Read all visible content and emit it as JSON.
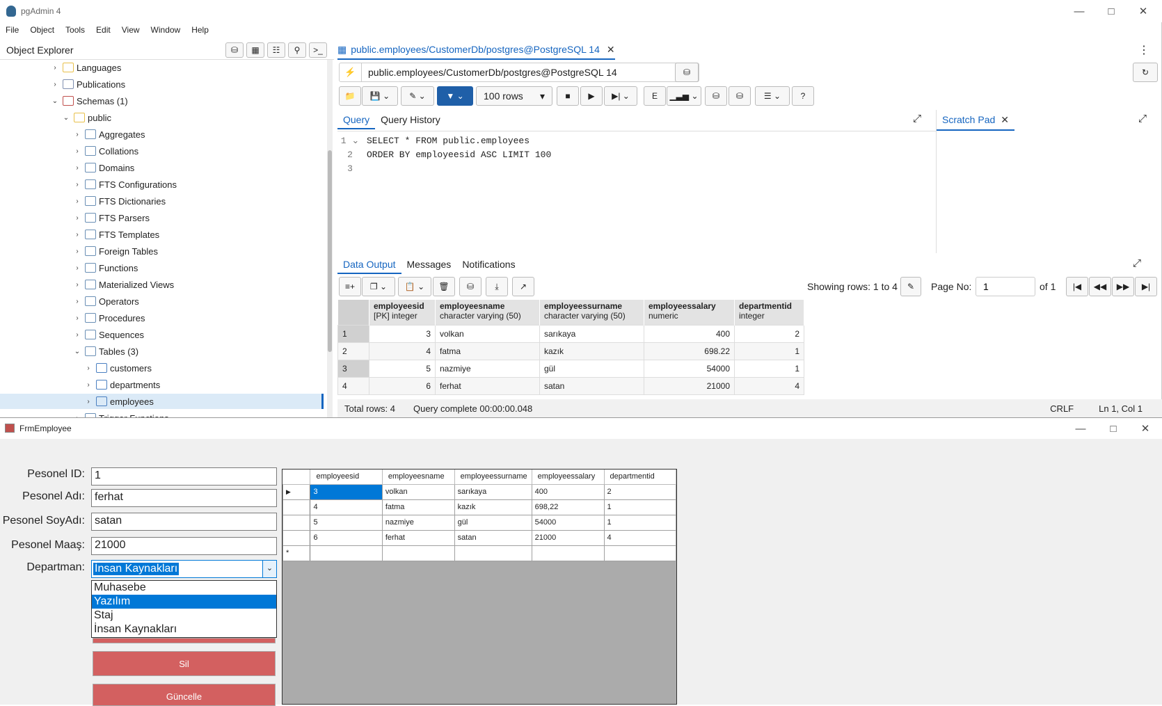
{
  "app": {
    "title": "pgAdmin 4",
    "menu": [
      "File",
      "Object",
      "Tools",
      "Edit",
      "View",
      "Window",
      "Help"
    ]
  },
  "object_explorer": {
    "title": "Object Explorer",
    "tree": [
      {
        "label": "Languages",
        "level": 0,
        "state": "collapsed",
        "icon": "language-icon"
      },
      {
        "label": "Publications",
        "level": 0,
        "state": "collapsed",
        "icon": "publication-icon"
      },
      {
        "label": "Schemas (1)",
        "level": 0,
        "state": "expanded",
        "icon": "schema-icon"
      },
      {
        "label": "public",
        "level": 1,
        "state": "expanded",
        "icon": "schema-public-icon"
      },
      {
        "label": "Aggregates",
        "level": 2,
        "state": "collapsed",
        "icon": "aggregate-icon"
      },
      {
        "label": "Collations",
        "level": 2,
        "state": "collapsed",
        "icon": "collation-icon"
      },
      {
        "label": "Domains",
        "level": 2,
        "state": "collapsed",
        "icon": "domain-icon"
      },
      {
        "label": "FTS Configurations",
        "level": 2,
        "state": "collapsed",
        "icon": "fts-config-icon"
      },
      {
        "label": "FTS Dictionaries",
        "level": 2,
        "state": "collapsed",
        "icon": "fts-dictionary-icon"
      },
      {
        "label": "FTS Parsers",
        "level": 2,
        "state": "collapsed",
        "icon": "fts-parser-icon"
      },
      {
        "label": "FTS Templates",
        "level": 2,
        "state": "collapsed",
        "icon": "fts-template-icon"
      },
      {
        "label": "Foreign Tables",
        "level": 2,
        "state": "collapsed",
        "icon": "foreign-table-icon"
      },
      {
        "label": "Functions",
        "level": 2,
        "state": "collapsed",
        "icon": "function-icon"
      },
      {
        "label": "Materialized Views",
        "level": 2,
        "state": "collapsed",
        "icon": "matview-icon"
      },
      {
        "label": "Operators",
        "level": 2,
        "state": "collapsed",
        "icon": "operator-icon"
      },
      {
        "label": "Procedures",
        "level": 2,
        "state": "collapsed",
        "icon": "procedure-icon"
      },
      {
        "label": "Sequences",
        "level": 2,
        "state": "collapsed",
        "icon": "sequence-icon"
      },
      {
        "label": "Tables (3)",
        "level": 2,
        "state": "expanded",
        "icon": "tables-icon"
      },
      {
        "label": "customers",
        "level": 3,
        "state": "collapsed",
        "icon": "table-icon"
      },
      {
        "label": "departments",
        "level": 3,
        "state": "collapsed",
        "icon": "table-icon"
      },
      {
        "label": "employees",
        "level": 3,
        "state": "collapsed",
        "icon": "table-icon",
        "selected": true
      },
      {
        "label": "Trigger Functions",
        "level": 2,
        "state": "collapsed",
        "icon": "trigger-function-icon"
      }
    ]
  },
  "query_tool": {
    "tab_label": "public.employees/CustomerDb/postgres@PostgreSQL 14",
    "connection": "public.employees/CustomerDb/postgres@PostgreSQL 14",
    "rows_limit": "100 rows",
    "editor_tabs": [
      "Query",
      "Query History"
    ],
    "scratch_pad": "Scratch Pad",
    "code_lines": [
      "SELECT * FROM public.employees",
      "ORDER BY employeesid ASC LIMIT 100",
      ""
    ],
    "output_tabs": [
      "Data Output",
      "Messages",
      "Notifications"
    ],
    "showing_rows": "Showing rows: 1 to 4",
    "page_no_label": "Page No:",
    "page_no": "1",
    "page_of": "of 1",
    "columns": [
      {
        "name": "employeesid",
        "type": "[PK] integer"
      },
      {
        "name": "employeesname",
        "type": "character varying (50)"
      },
      {
        "name": "employeessurname",
        "type": "character varying (50)"
      },
      {
        "name": "employeessalary",
        "type": "numeric"
      },
      {
        "name": "departmentid",
        "type": "integer"
      }
    ],
    "rows": [
      [
        "1",
        "3",
        "volkan",
        "sarıkaya",
        "400",
        "2"
      ],
      [
        "2",
        "4",
        "fatma",
        "kazık",
        "698.22",
        "1"
      ],
      [
        "3",
        "5",
        "nazmiye",
        "gül",
        "54000",
        "1"
      ],
      [
        "4",
        "6",
        "ferhat",
        "satan",
        "21000",
        "4"
      ]
    ],
    "status": {
      "total": "Total rows: 4",
      "query": "Query complete 00:00:00.048",
      "eol": "CRLF",
      "pos": "Ln 1, Col 1"
    }
  },
  "form": {
    "title": "FrmEmployee",
    "labels": {
      "id": "Pesonel ID:",
      "name": "Pesonel Adı:",
      "surname": "Pesonel SoyAdı:",
      "salary": "Pesonel Maaş:",
      "dept": "Departman:"
    },
    "values": {
      "id": "1",
      "name": "ferhat",
      "surname": "satan",
      "salary": "21000",
      "dept": "İnsan Kaynakları"
    },
    "dept_options": [
      "Muhasebe",
      "Yazılım",
      "Staj",
      "İnsan Kaynakları"
    ],
    "buttons": {
      "delete": "Sil",
      "update": "Güncelle"
    },
    "grid_columns": [
      "employeesid",
      "employeesname",
      "employeessurname",
      "employeessalary",
      "departmentid"
    ],
    "grid_rows": [
      [
        "3",
        "volkan",
        "sarıkaya",
        "400",
        "2"
      ],
      [
        "4",
        "fatma",
        "kazık",
        "698,22",
        "1"
      ],
      [
        "5",
        "nazmiye",
        "gül",
        "54000",
        "1"
      ],
      [
        "6",
        "ferhat",
        "satan",
        "21000",
        "4"
      ]
    ],
    "new_row_marker": "*"
  },
  "colors": {
    "accent": "#1565c0",
    "button_red": "#d36060",
    "selection": "#0078d7"
  }
}
